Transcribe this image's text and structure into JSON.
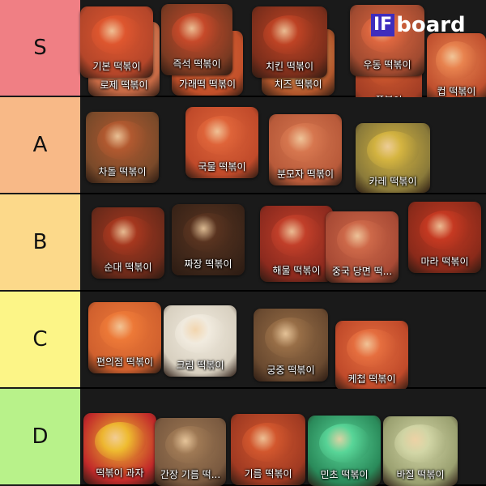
{
  "app": {
    "logo_prefix": "IF",
    "logo_suffix": "board"
  },
  "tiers": [
    {
      "label": "S",
      "color": "#f07f84",
      "items": [
        {
          "name": "기본 떡볶이",
          "bg": "#b4462a",
          "sauce": "#e0572f"
        },
        {
          "name": "즉석 떡볶이",
          "bg": "#7a3a22",
          "sauce": "#c94a2a"
        },
        {
          "name": "치킨 떡볶이",
          "bg": "#7b2e1b",
          "sauce": "#c14425"
        },
        {
          "name": "우동 떡볶이",
          "bg": "#a04a30",
          "sauce": "#e06840"
        },
        {
          "name": "로제 떡볶이",
          "bg": "#c76a45",
          "sauce": "#e79b6f"
        },
        {
          "name": "가래떡 떡볶이",
          "bg": "#c2502a",
          "sauce": "#d9683a"
        },
        {
          "name": "치즈 떡볶이",
          "bg": "#b2572c",
          "sauce": "#e6b46a"
        },
        {
          "name": "쫄볶이",
          "bg": "#a33e25",
          "sauce": "#d15a2f"
        },
        {
          "name": "컵 떡볶이",
          "bg": "#bf4f2e",
          "sauce": "#ea8550"
        }
      ]
    },
    {
      "label": "A",
      "color": "#f8b987",
      "items": [
        {
          "name": "차돌 떡볶이",
          "bg": "#7a4a2a",
          "sauce": "#b45a30"
        },
        {
          "name": "국물 떡볶이",
          "bg": "#c04a2a",
          "sauce": "#e0653a"
        },
        {
          "name": "분모자 떡볶이",
          "bg": "#b85a3a",
          "sauce": "#d87850"
        },
        {
          "name": "카레 떡볶이",
          "bg": "#8a7a3a",
          "sauce": "#d7b640"
        }
      ]
    },
    {
      "label": "B",
      "color": "#fcd98a",
      "items": [
        {
          "name": "순대 떡볶이",
          "bg": "#6b2a1a",
          "sauce": "#a8381f"
        },
        {
          "name": "짜장 떡볶이",
          "bg": "#3a2418",
          "sauce": "#5a3420"
        },
        {
          "name": "해물 떡볶이",
          "bg": "#8c2a1e",
          "sauce": "#c4402a"
        },
        {
          "name": "중국 당면 떡...",
          "bg": "#a84a35",
          "sauce": "#cf6a4a"
        },
        {
          "name": "마라 떡볶이",
          "bg": "#8a2a1a",
          "sauce": "#c83a22"
        }
      ]
    },
    {
      "label": "C",
      "color": "#fcf587",
      "items": [
        {
          "name": "편의점 떡볶이",
          "bg": "#d0602e",
          "sauce": "#ee7a38"
        },
        {
          "name": "크림 떡볶이",
          "bg": "#d8d0c0",
          "sauce": "#f2ece0"
        },
        {
          "name": "궁중 떡볶이",
          "bg": "#6a4a30",
          "sauce": "#9a7048"
        },
        {
          "name": "케첩 떡볶이",
          "bg": "#c04a2a",
          "sauce": "#e77040"
        }
      ]
    },
    {
      "label": "D",
      "color": "#b8f28a",
      "items": [
        {
          "name": "떡볶이 과자",
          "bg": "#c22a2a",
          "sauce": "#f0c030"
        },
        {
          "name": "간장 기름 떡...",
          "bg": "#7a5a40",
          "sauce": "#a07a55"
        },
        {
          "name": "기름 떡볶이",
          "bg": "#a03a22",
          "sauce": "#d4582e"
        },
        {
          "name": "민초 떡볶이",
          "bg": "#2a8a5a",
          "sauce": "#5ad89a"
        },
        {
          "name": "바질 떡볶이",
          "bg": "#9aa070",
          "sauce": "#d4d8a8"
        }
      ]
    }
  ]
}
